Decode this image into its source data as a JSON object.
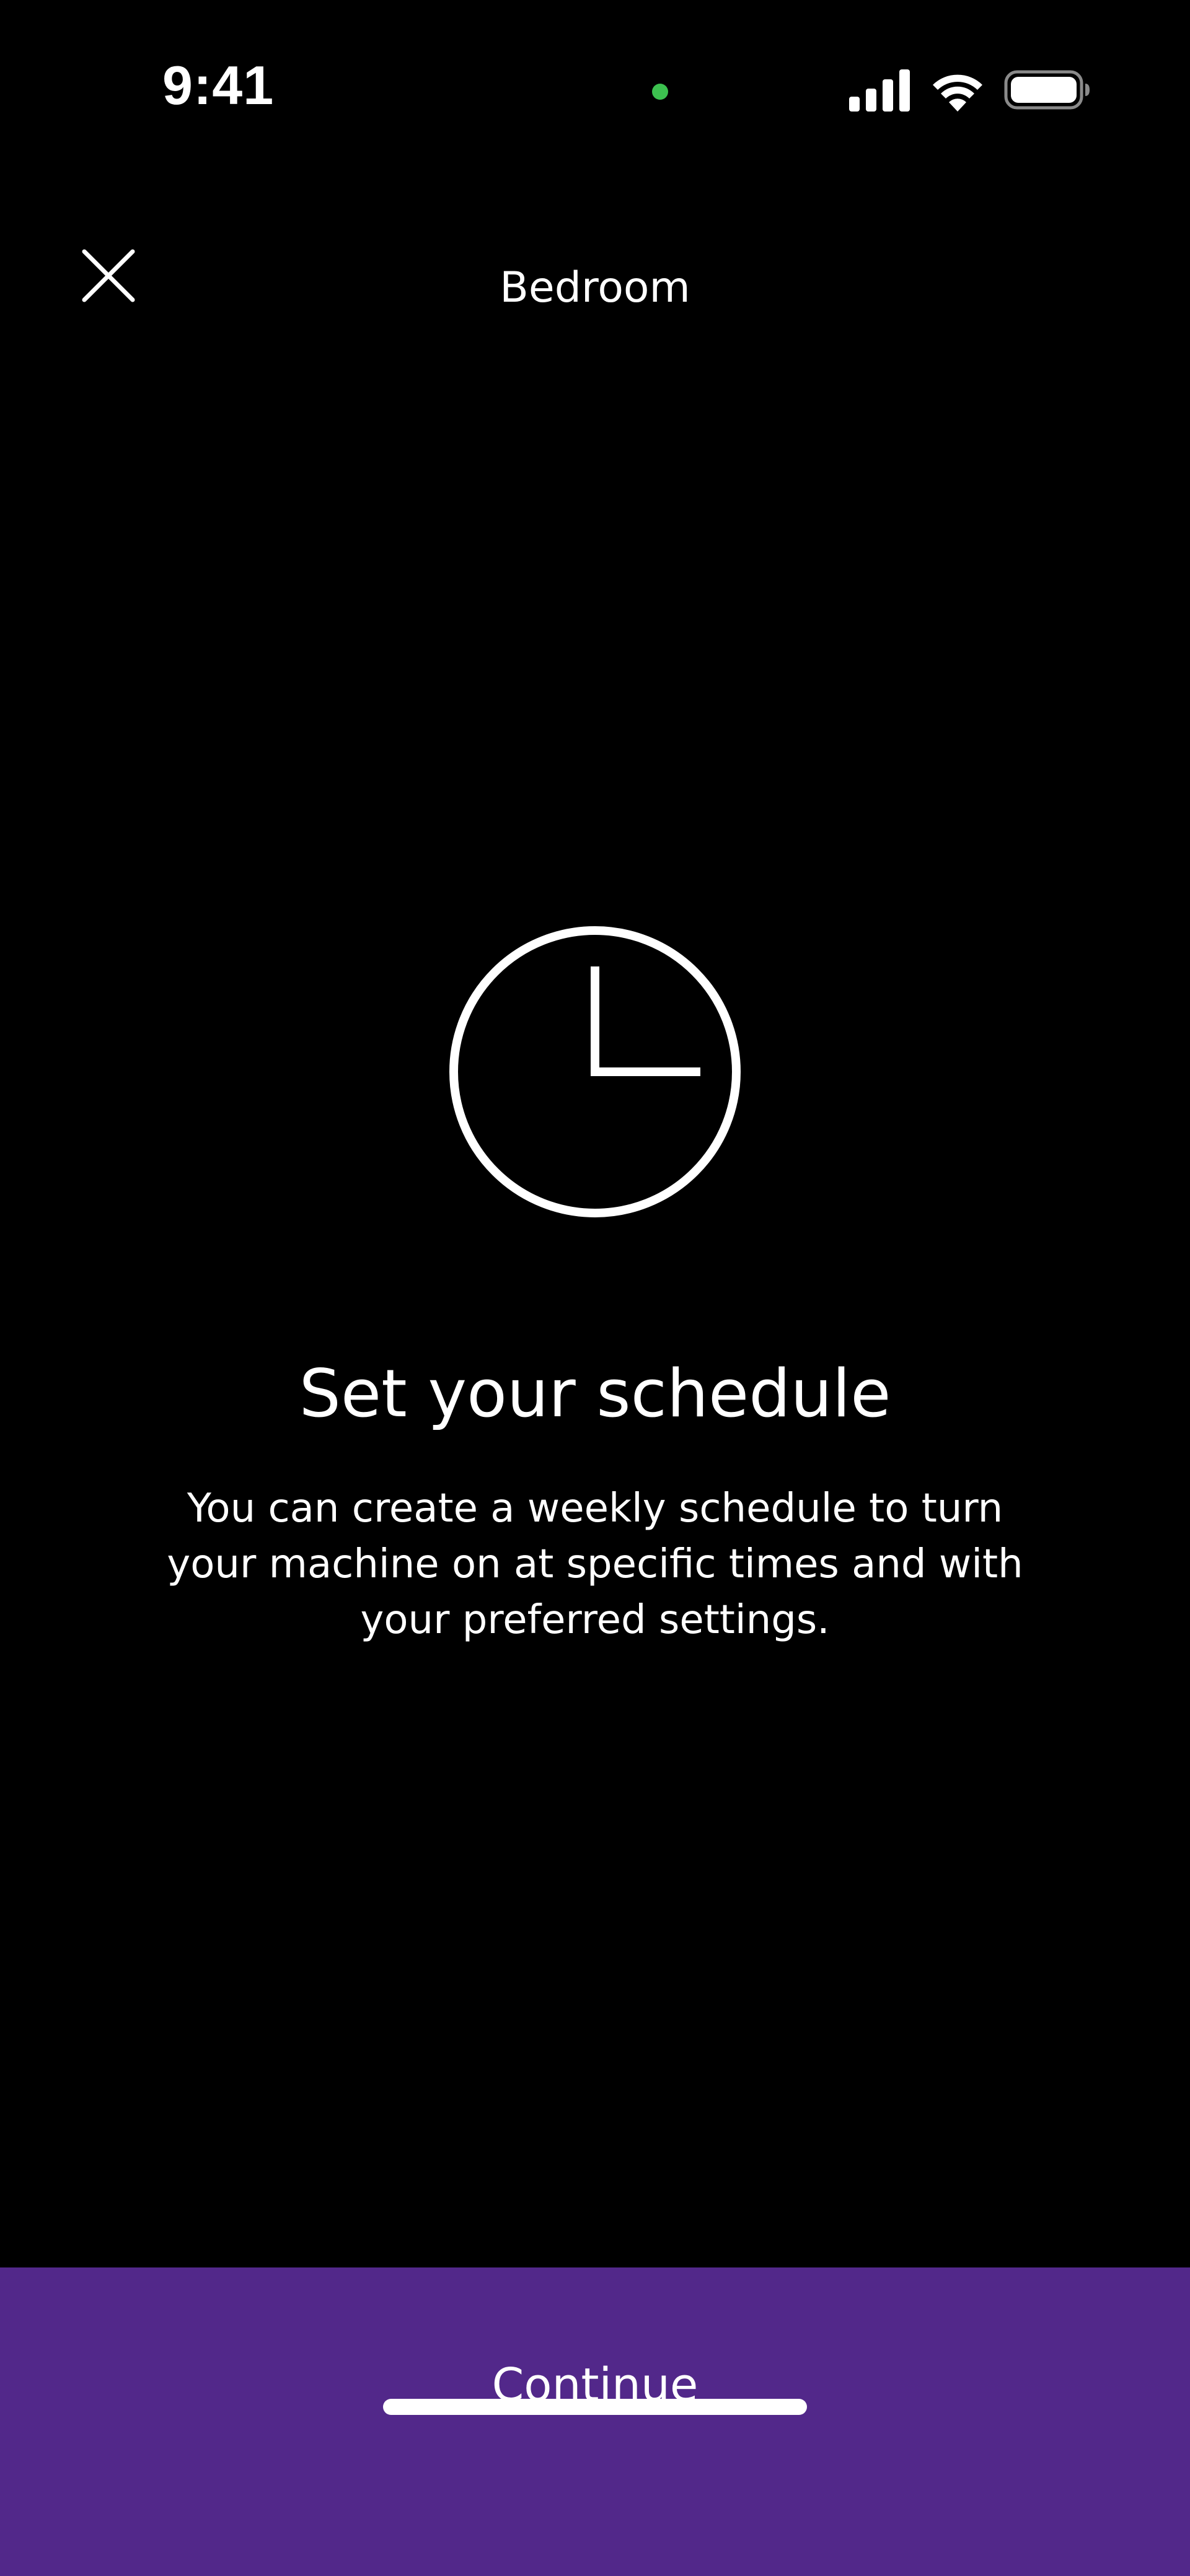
{
  "status_bar": {
    "time": "9:41",
    "dot_color": "#3cc14f",
    "icons": [
      "cellular-signal-icon",
      "wifi-icon",
      "battery-icon"
    ]
  },
  "header": {
    "title": "Bedroom",
    "close_icon": "close-icon"
  },
  "hero": {
    "icon": "clock-icon",
    "title": "Set your schedule",
    "body": "You can create a weekly schedule to turn your machine on at specific times and with your preferred settings."
  },
  "footer": {
    "continue_label": "Continue",
    "background_color": "#52288a"
  }
}
